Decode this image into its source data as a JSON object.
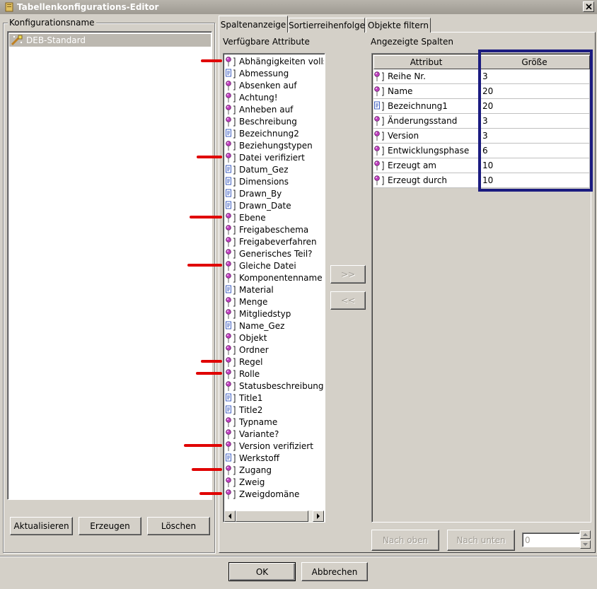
{
  "window": {
    "title": "Tabellenkonfigurations-Editor"
  },
  "colors": {
    "pin_pink": "#c040c0",
    "doc_blue": "#4060c0",
    "highlight_navy": "#1b1b80",
    "marker_red": "#e00000"
  },
  "config_group": {
    "legend": "Konfigurationsname",
    "items": [
      {
        "label": "DEB-Standard",
        "icon": "config-wand-icon",
        "selected": true
      }
    ]
  },
  "left_buttons": {
    "refresh": "Aktualisieren",
    "create": "Erzeugen",
    "delete": "Löschen"
  },
  "tabs": [
    {
      "label": "Spaltenanzeige",
      "active": true
    },
    {
      "label": "Sortierreihenfolge",
      "active": false
    },
    {
      "label": "Objekte filtern",
      "active": false
    }
  ],
  "available": {
    "label": "Verfügbare Attribute",
    "items": [
      {
        "label": "Abhängigkeiten vollständig",
        "icon": "pin-icon",
        "marked": true
      },
      {
        "label": "Abmessung",
        "icon": "doc-icon",
        "marked": false
      },
      {
        "label": "Absenken auf",
        "icon": "pin-icon",
        "marked": false
      },
      {
        "label": "Achtung!",
        "icon": "pin-icon",
        "marked": false
      },
      {
        "label": "Anheben auf",
        "icon": "pin-icon",
        "marked": false
      },
      {
        "label": "Beschreibung",
        "icon": "pin-icon",
        "marked": false
      },
      {
        "label": "Bezeichnung2",
        "icon": "doc-icon",
        "marked": false
      },
      {
        "label": "Beziehungstypen",
        "icon": "pin-icon",
        "marked": false
      },
      {
        "label": "Datei verifiziert",
        "icon": "pin-icon",
        "marked": true
      },
      {
        "label": "Datum_Gez",
        "icon": "doc-icon",
        "marked": false
      },
      {
        "label": "Dimensions",
        "icon": "doc-icon",
        "marked": false
      },
      {
        "label": "Drawn_By",
        "icon": "doc-icon",
        "marked": false
      },
      {
        "label": "Drawn_Date",
        "icon": "doc-icon",
        "marked": false
      },
      {
        "label": "Ebene",
        "icon": "pin-icon",
        "marked": true
      },
      {
        "label": "Freigabeschema",
        "icon": "pin-icon",
        "marked": false
      },
      {
        "label": "Freigabeverfahren",
        "icon": "pin-icon",
        "marked": false
      },
      {
        "label": "Generisches Teil?",
        "icon": "pin-icon",
        "marked": false
      },
      {
        "label": "Gleiche Datei",
        "icon": "pin-icon",
        "marked": true
      },
      {
        "label": "Komponentenname",
        "icon": "pin-icon",
        "marked": false
      },
      {
        "label": "Material",
        "icon": "doc-icon",
        "marked": false
      },
      {
        "label": "Menge",
        "icon": "pin-icon",
        "marked": false
      },
      {
        "label": "Mitgliedstyp",
        "icon": "pin-icon",
        "marked": false
      },
      {
        "label": "Name_Gez",
        "icon": "doc-icon",
        "marked": false
      },
      {
        "label": "Objekt",
        "icon": "pin-icon",
        "marked": false
      },
      {
        "label": "Ordner",
        "icon": "pin-icon",
        "marked": false
      },
      {
        "label": "Regel",
        "icon": "pin-icon",
        "marked": true
      },
      {
        "label": "Rolle",
        "icon": "pin-icon",
        "marked": true
      },
      {
        "label": "Statusbeschreibung",
        "icon": "pin-icon",
        "marked": false
      },
      {
        "label": "Title1",
        "icon": "doc-icon",
        "marked": false
      },
      {
        "label": "Title2",
        "icon": "doc-icon",
        "marked": false
      },
      {
        "label": "Typname",
        "icon": "pin-icon",
        "marked": false
      },
      {
        "label": "Variante?",
        "icon": "pin-icon",
        "marked": false
      },
      {
        "label": "Version verifiziert",
        "icon": "pin-icon",
        "marked": true
      },
      {
        "label": "Werkstoff",
        "icon": "doc-icon",
        "marked": false
      },
      {
        "label": "Zugang",
        "icon": "pin-icon",
        "marked": true
      },
      {
        "label": "Zweig",
        "icon": "pin-icon",
        "marked": false
      },
      {
        "label": "Zweigdomäne",
        "icon": "pin-icon",
        "marked": true
      }
    ]
  },
  "move_buttons": {
    "add": ">>",
    "remove": "<<"
  },
  "displayed": {
    "label": "Angezeigte Spalten",
    "columns": [
      "Attribut",
      "Größe"
    ],
    "rows": [
      {
        "attribute": "Reihe Nr.",
        "size": "3",
        "icon": "pin-icon"
      },
      {
        "attribute": "Name",
        "size": "20",
        "icon": "pin-icon"
      },
      {
        "attribute": "Bezeichnung1",
        "size": "20",
        "icon": "doc-icon"
      },
      {
        "attribute": "Änderungsstand",
        "size": "3",
        "icon": "pin-icon"
      },
      {
        "attribute": "Version",
        "size": "3",
        "icon": "pin-icon"
      },
      {
        "attribute": "Entwicklungsphase",
        "size": "6",
        "icon": "pin-icon"
      },
      {
        "attribute": "Erzeugt am",
        "size": "10",
        "icon": "pin-icon"
      },
      {
        "attribute": "Erzeugt durch",
        "size": "10",
        "icon": "pin-icon"
      }
    ]
  },
  "order_buttons": {
    "up": "Nach oben",
    "down": "Nach unten",
    "position_value": "0"
  },
  "dialog_buttons": {
    "ok": "OK",
    "cancel": "Abbrechen"
  }
}
